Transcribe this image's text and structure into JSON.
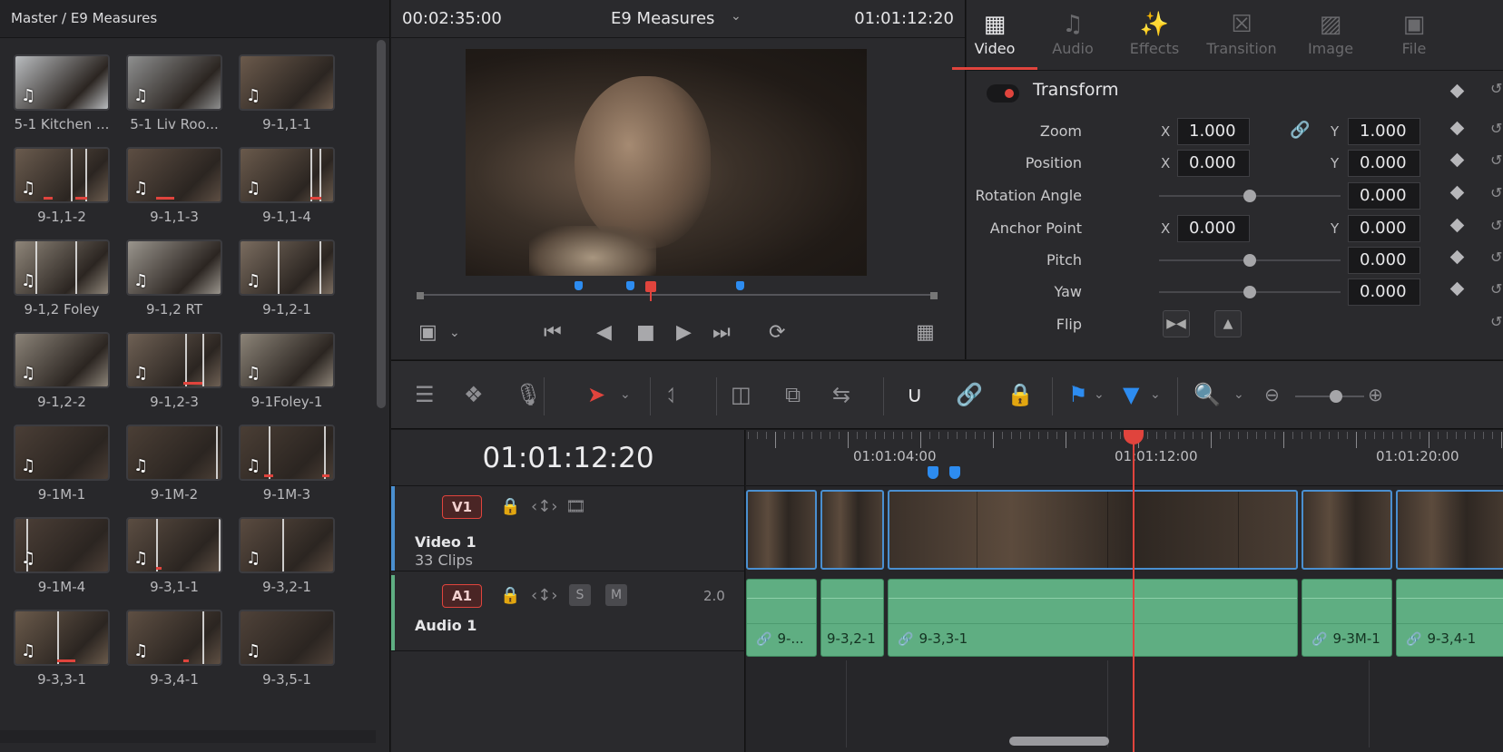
{
  "media_pool": {
    "breadcrumb": "Master / E9 Measures",
    "clips": [
      {
        "name": "5-1 Kitchen ...",
        "tone": "#b9bcbf",
        "lines": [],
        "bars": []
      },
      {
        "name": "5-1 Liv Roo...",
        "tone": "#8e8f8f",
        "lines": [],
        "bars": []
      },
      {
        "name": "9-1,1-1",
        "tone": "#6b5a4c",
        "lines": [],
        "bars": []
      },
      {
        "name": "9-1,1-2",
        "tone": "#6a5b4e",
        "lines": [
          0.6,
          0.75
        ],
        "bars": [
          [
            0.3,
            0.1
          ],
          [
            0.65,
            0.12
          ]
        ]
      },
      {
        "name": "9-1,1-3",
        "tone": "#5d4e43",
        "lines": [],
        "bars": [
          [
            0.3,
            0.2
          ]
        ]
      },
      {
        "name": "9-1,1-4",
        "tone": "#6a5a4c",
        "lines": [
          0.75,
          0.85
        ],
        "bars": [
          [
            0.75,
            0.12
          ]
        ]
      },
      {
        "name": "9-1,2 Foley",
        "tone": "#8e8579",
        "lines": [
          0.22,
          0.65
        ],
        "bars": []
      },
      {
        "name": "9-1,2 RT",
        "tone": "#9a958d",
        "lines": [],
        "bars": []
      },
      {
        "name": "9-1,2-1",
        "tone": "#7a6c5f",
        "lines": [
          0.4,
          0.85
        ],
        "bars": []
      },
      {
        "name": "9-1,2-2",
        "tone": "#8b8378",
        "lines": [],
        "bars": []
      },
      {
        "name": "9-1,2-3",
        "tone": "#6e6054",
        "lines": [
          0.62,
          0.8
        ],
        "bars": [
          [
            0.6,
            0.2
          ]
        ]
      },
      {
        "name": "9-1Foley-1",
        "tone": "#8c8478",
        "lines": [],
        "bars": []
      },
      {
        "name": "9-1M-1",
        "tone": "#4a3e36",
        "lines": [],
        "bars": []
      },
      {
        "name": "9-1M-2",
        "tone": "#4b3f36",
        "lines": [
          0.95
        ],
        "bars": []
      },
      {
        "name": "9-1M-3",
        "tone": "#4a3e35",
        "lines": [
          0.3,
          0.9
        ],
        "bars": [
          [
            0.25,
            0.1
          ],
          [
            0.88,
            0.08
          ]
        ]
      },
      {
        "name": "9-1M-4",
        "tone": "#4d4038",
        "lines": [
          0.12
        ],
        "bars": []
      },
      {
        "name": "9-3,1-1",
        "tone": "#5b4d42",
        "lines": [
          0.3,
          0.98
        ],
        "bars": [
          [
            0.3,
            0.06
          ]
        ]
      },
      {
        "name": "9-3,2-1",
        "tone": "#5a4b40",
        "lines": [
          0.45
        ],
        "bars": []
      },
      {
        "name": "9-3,3-1",
        "tone": "#6a5a4b",
        "lines": [
          0.45
        ],
        "bars": [
          [
            0.45,
            0.2
          ]
        ]
      },
      {
        "name": "9-3,4-1",
        "tone": "#5e4f43",
        "lines": [
          0.8
        ],
        "bars": [
          [
            0.6,
            0.06
          ]
        ]
      },
      {
        "name": "9-3,5-1",
        "tone": "#4f4239",
        "lines": [],
        "bars": []
      }
    ]
  },
  "viewer": {
    "source_timecode": "00:02:35:00",
    "title": "E9 Measures",
    "record_timecode": "01:01:12:20",
    "scrub_markers": [
      0.31,
      0.41,
      0.62
    ],
    "playhead": 0.45
  },
  "inspector": {
    "tabs": [
      {
        "label": "Video",
        "icon": "▦",
        "active": true
      },
      {
        "label": "Audio",
        "icon": "♫",
        "active": false
      },
      {
        "label": "Effects",
        "icon": "✨",
        "active": false
      },
      {
        "label": "Transition",
        "icon": "☒",
        "active": false
      },
      {
        "label": "Image",
        "icon": "▨",
        "active": false
      },
      {
        "label": "File",
        "icon": "▣",
        "active": false
      }
    ],
    "section": "Transform",
    "x_axis": "X",
    "y_axis": "Y",
    "zoom": {
      "label": "Zoom",
      "x": "1.000",
      "y": "1.000"
    },
    "position": {
      "label": "Position",
      "x": "0.000",
      "y": "0.000"
    },
    "rotation": {
      "label": "Rotation Angle",
      "value": "0.000"
    },
    "anchor": {
      "label": "Anchor Point",
      "x": "0.000",
      "y": "0.000"
    },
    "pitch": {
      "label": "Pitch",
      "value": "0.000"
    },
    "yaw": {
      "label": "Yaw",
      "value": "0.000"
    },
    "flip": {
      "label": "Flip"
    }
  },
  "timeline": {
    "timecode": "01:01:12:20",
    "ruler": [
      "01:01:04:00",
      "01:01:12:00",
      "01:01:20:00"
    ],
    "video_track": {
      "badge": "V1",
      "name": "Video 1",
      "sub": "33 Clips"
    },
    "audio_track": {
      "badge": "A1",
      "name": "Audio 1",
      "solo": "S",
      "mute": "M",
      "level": "2.0"
    },
    "audio_clips": [
      "9-...",
      "9-3,2-1",
      "9-3,3-1",
      "9-3M-1",
      "9-3,4-1"
    ]
  },
  "colors": {
    "accent": "#e0443d",
    "marker": "#2d8cf0",
    "audio": "#5fae82",
    "video_border": "#4a8fd0"
  }
}
